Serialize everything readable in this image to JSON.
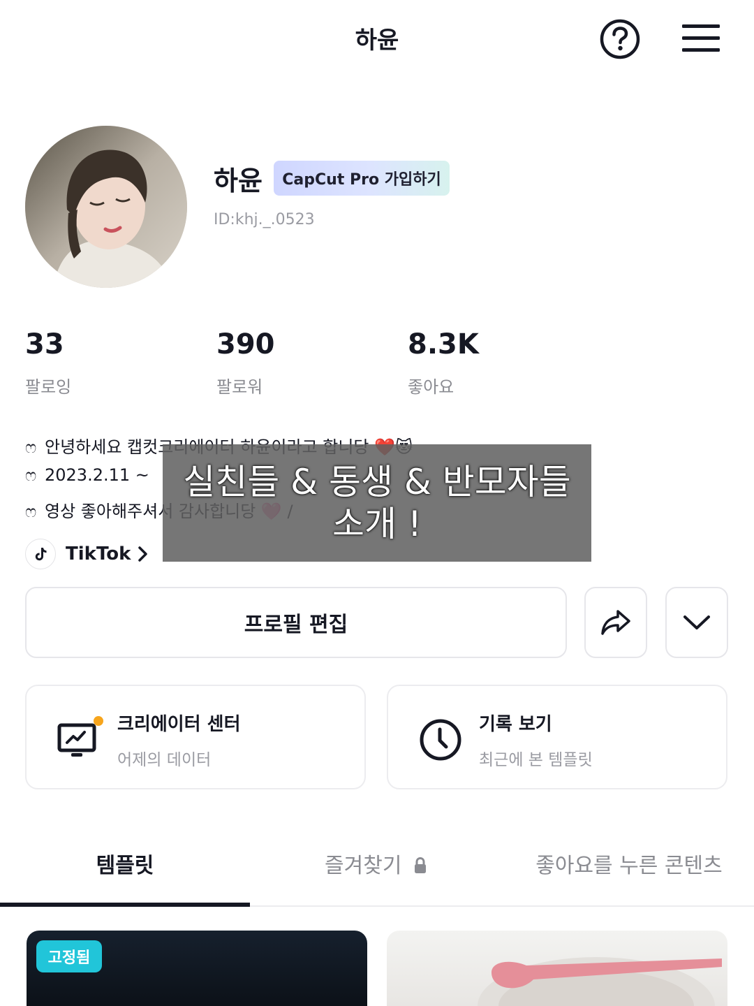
{
  "header": {
    "title": "하윤",
    "help_icon": "question-circle-icon",
    "menu_icon": "hamburger-menu-icon"
  },
  "profile": {
    "name": "하윤",
    "pro_badge": "CapCut Pro 가입하기",
    "user_id": "ID:khj._.0523"
  },
  "stats": [
    {
      "value": "33",
      "label": "팔로잉"
    },
    {
      "value": "390",
      "label": "팔로워"
    },
    {
      "value": "8.3K",
      "label": "좋아요"
    }
  ],
  "bio": {
    "marker": "ෆ",
    "lines": [
      "안녕하세요 캡컷크리에이터 하윤이라고 합니당 ❤️😻",
      "2023.2.11 ~",
      "영상 좋아해주셔서 감사합니당 🩷 /"
    ]
  },
  "tiktok": {
    "label": "TikTok"
  },
  "overlay": {
    "line1": "실친들 & 동생 & 반모자들",
    "line2": "소개 !"
  },
  "actions": {
    "edit_profile": "프로필 편집"
  },
  "cards": [
    {
      "title": "크리에이터 센터",
      "subtitle": "어제의 데이터",
      "icon": "monitor-chart-icon"
    },
    {
      "title": "기록 보기",
      "subtitle": "최근에 본 템플릿",
      "icon": "clock-icon"
    }
  ],
  "tabs": [
    {
      "label": "템플릿",
      "active": true
    },
    {
      "label": "즐겨찾기",
      "active": false
    },
    {
      "label": "좋아요를 누른 콘텐츠",
      "active": false
    }
  ],
  "grid": {
    "pinned_badge": "고정됨"
  },
  "colors": {
    "text": "#161823",
    "muted": "#8a8b91",
    "pin_badge": "#21c5d9",
    "notification_dot": "#f7a51c"
  }
}
